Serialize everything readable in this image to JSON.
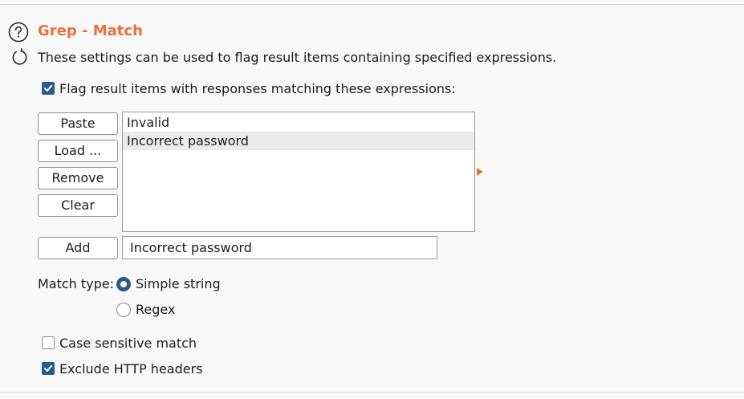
{
  "section": {
    "title": "Grep - Match",
    "description": "These settings can be used to flag result items containing specified expressions.",
    "help_icon": "question-circle-icon",
    "reset_icon": "reset-circular-arrow-icon"
  },
  "flag_checkbox": {
    "label": "Flag result items with responses matching these expressions:",
    "checked": true
  },
  "buttons": {
    "paste": "Paste",
    "load": "Load ...",
    "remove": "Remove",
    "clear": "Clear",
    "add": "Add"
  },
  "expressions": {
    "items": [
      "Invalid",
      "Incorrect password"
    ],
    "selected_index": 1
  },
  "add_input": {
    "value": "Incorrect password"
  },
  "match_type": {
    "label": "Match type:",
    "options": [
      "Simple string",
      "Regex"
    ],
    "selected": "Simple string"
  },
  "options": {
    "case_sensitive": {
      "label": "Case sensitive match",
      "checked": false
    },
    "exclude_headers": {
      "label": "Exclude HTTP headers",
      "checked": true
    }
  },
  "colors": {
    "title": "#e8713a",
    "accent": "#2b5b8c",
    "background": "#f8f8f8"
  }
}
